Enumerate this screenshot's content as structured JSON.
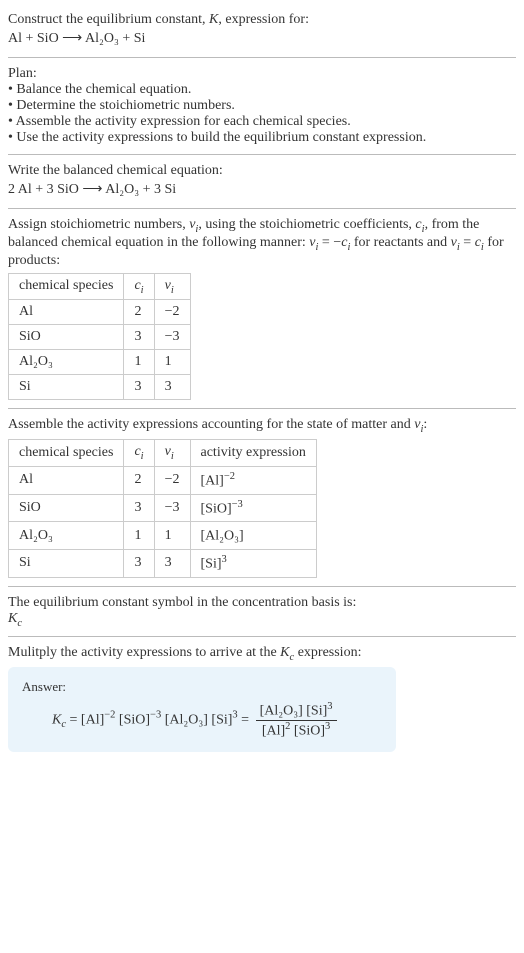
{
  "intro": {
    "line1": "Construct the equilibrium constant, ",
    "K": "K",
    "line1b": ", expression for:",
    "equation": "Al + SiO ⟶ Al₂O₃ + Si"
  },
  "plan": {
    "title": "Plan:",
    "b1": "• Balance the chemical equation.",
    "b2": "• Determine the stoichiometric numbers.",
    "b3": "• Assemble the activity expression for each chemical species.",
    "b4": "• Use the activity expressions to build the equilibrium constant expression."
  },
  "balanced": {
    "title": "Write the balanced chemical equation:",
    "equation": "2 Al + 3 SiO ⟶ Al₂O₃ + 3 Si"
  },
  "assign": {
    "text1": "Assign stoichiometric numbers, ",
    "nu": "ν",
    "sub_i": "i",
    "text2": ", using the stoichiometric coefficients, ",
    "c": "c",
    "text3": ", from the balanced chemical equation in the following manner: ",
    "rel1a": "ν",
    "rel1b": " = −",
    "rel1c": "c",
    "text4": " for reactants and ",
    "rel2a": "ν",
    "rel2b": " = ",
    "rel2c": "c",
    "text5": " for products:",
    "headers": {
      "species": "chemical species",
      "ci": "c",
      "nui": "ν"
    },
    "rows": [
      {
        "species": "Al",
        "ci": "2",
        "nui": "−2"
      },
      {
        "species": "SiO",
        "ci": "3",
        "nui": "−3"
      },
      {
        "species": "Al₂O₃",
        "ci": "1",
        "nui": "1"
      },
      {
        "species": "Si",
        "ci": "3",
        "nui": "3"
      }
    ]
  },
  "assemble": {
    "text1": "Assemble the activity expressions accounting for the state of matter and ",
    "nu": "ν",
    "sub_i": "i",
    "text2": ":",
    "headers": {
      "species": "chemical species",
      "ci": "c",
      "nui": "ν",
      "activity": "activity expression"
    },
    "rows": [
      {
        "species": "Al",
        "ci": "2",
        "nui": "−2",
        "act": "[Al]",
        "exp": "−2"
      },
      {
        "species": "SiO",
        "ci": "3",
        "nui": "−3",
        "act": "[SiO]",
        "exp": "−3"
      },
      {
        "species": "Al₂O₃",
        "ci": "1",
        "nui": "1",
        "act": "[Al₂O₃]",
        "exp": ""
      },
      {
        "species": "Si",
        "ci": "3",
        "nui": "3",
        "act": "[Si]",
        "exp": "3"
      }
    ]
  },
  "symbol": {
    "text": "The equilibrium constant symbol in the concentration basis is:",
    "Kc": "K",
    "c": "c"
  },
  "multiply": {
    "text1": "Mulitply the activity expressions to arrive at the ",
    "Kc": "K",
    "c": "c",
    "text2": " expression:"
  },
  "answer": {
    "label": "Answer:",
    "Kc": "K",
    "c": "c",
    "eq": " = ",
    "t1": "[Al]",
    "e1": "−2",
    "t2": " [SiO]",
    "e2": "−3",
    "t3": " [Al₂O₃] [Si]",
    "e3": "3",
    "eq2": " = ",
    "num": "[Al₂O₃] [Si]",
    "num_e": "3",
    "den1": "[Al]",
    "den1_e": "2",
    "den2": " [SiO]",
    "den2_e": "3"
  }
}
